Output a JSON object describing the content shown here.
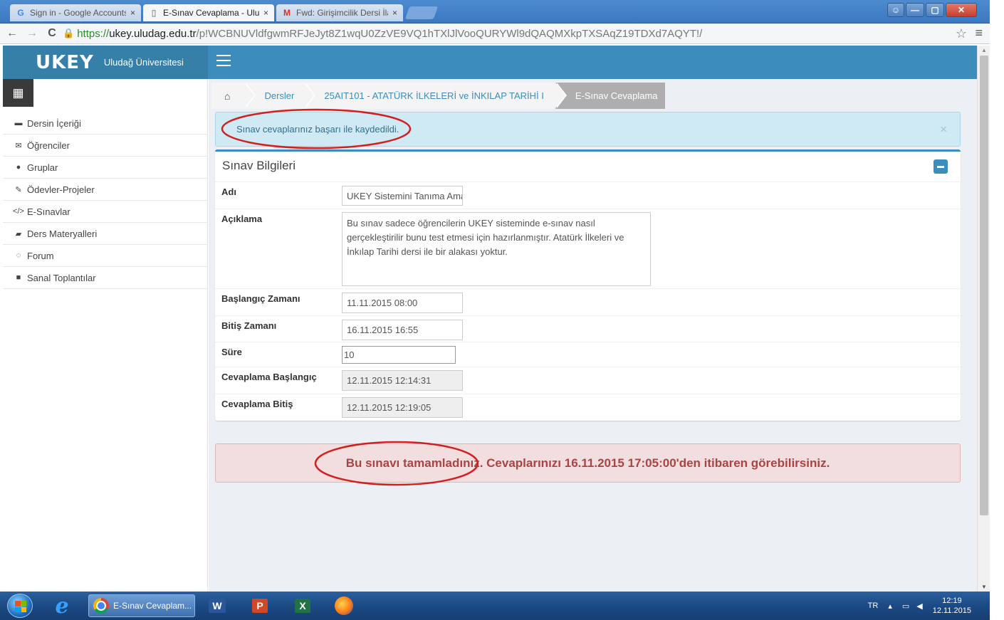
{
  "browser": {
    "tabs": [
      {
        "label": "Sign in - Google Accounts",
        "active": false,
        "icon": "google-g-icon"
      },
      {
        "label": "E-Sınav Cevaplama - Uluda",
        "active": true,
        "icon": "page-icon"
      },
      {
        "label": "Fwd: Girişimcilik Dersi İlan",
        "active": false,
        "icon": "gmail-icon"
      }
    ],
    "tab_close": "×",
    "url_scheme": "https://",
    "url_host": "ukey.uludag.edu.tr",
    "url_path": "/p!WCBNUVldfgwmRFJeJyt8Z1wqU0ZzVE9VQ1hTXlJlVooQURYWl9dQAQMXkpTXSAqZ19TDXd7AQYT!/"
  },
  "header": {
    "logo": "UKEY",
    "university": "Uludağ Üniversitesi",
    "brand_color": "#3c8dbc"
  },
  "sidebar": {
    "items": [
      {
        "label": "Dersin İçeriği",
        "icon": "folder-icon"
      },
      {
        "label": "Öğrenciler",
        "icon": "envelope-icon"
      },
      {
        "label": "Gruplar",
        "icon": "users-icon"
      },
      {
        "label": "Ödevler-Projeler",
        "icon": "edit-icon"
      },
      {
        "label": "E-Sınavlar",
        "icon": "code-icon"
      },
      {
        "label": "Ders Materyalleri",
        "icon": "book-icon"
      },
      {
        "label": "Forum",
        "icon": "comments-icon"
      },
      {
        "label": "Sanal Toplantılar",
        "icon": "video-camera-icon"
      }
    ]
  },
  "breadcrumb": {
    "items": [
      "Dersler",
      "25AIT101 - ATATÜRK İLKELERİ ve İNKILAP TARİHİ I",
      "E-Sınav Cevaplama"
    ]
  },
  "alert_info": {
    "text": "Sınav cevaplarınız başarı ile kaydedildi.",
    "close": "×"
  },
  "exam": {
    "title": "Sınav Bilgileri",
    "fields": {
      "name": {
        "label": "Adı",
        "value": "UKEY Sistemini Tanıma Amaçlı"
      },
      "description": {
        "label": "Açıklama",
        "value": "Bu sınav sadece öğrencilerin UKEY sisteminde e-sınav nasıl gerçekleştirilir bunu test etmesi için hazırlanmıştır. Atatürk İlkeleri ve İnkılap Tarihi dersi ile bir alakası yoktur."
      },
      "start": {
        "label": "Başlangıç Zamanı",
        "value": "11.11.2015 08:00"
      },
      "end": {
        "label": "Bitiş Zamanı",
        "value": "16.11.2015 16:55"
      },
      "duration": {
        "label": "Süre",
        "value": "10"
      },
      "answer_start": {
        "label": "Cevaplama Başlangıç",
        "value": "12.11.2015 12:14:31"
      },
      "answer_end": {
        "label": "Cevaplama Bitiş",
        "value": "12.11.2015 12:19:05"
      }
    }
  },
  "alert_danger": {
    "text": "Bu sınavı tamamladınız. Cevaplarınızı 16.11.2015 17:05:00'den itibaren görebilirsiniz."
  },
  "taskbar": {
    "active_app": "E-Sınav Cevaplam...",
    "word_label": "W",
    "ppt_label": "P",
    "excel_label": "X",
    "lang": "TR",
    "time": "12:19",
    "date": "12.11.2015"
  }
}
